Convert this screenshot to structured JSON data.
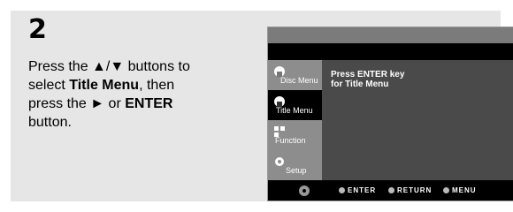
{
  "step": {
    "number": "2"
  },
  "instructions": {
    "line1": "Press the ▲/▼ buttons to",
    "line2_prefix": "select ",
    "line2_bold": "Title Menu",
    "line2_suffix": ", then",
    "line3_prefix": "press the ► or ",
    "line3_bold": "ENTER",
    "line4": "button."
  },
  "osd": {
    "menu": [
      {
        "label": "Disc Menu",
        "icon": "disc-icon",
        "active": false
      },
      {
        "label": "Title Menu",
        "icon": "title-icon",
        "active": true
      },
      {
        "label": "Function",
        "icon": "function-icon",
        "active": false
      },
      {
        "label": "Setup",
        "icon": "gear-icon",
        "active": false
      }
    ],
    "message_line1": "Press ENTER key",
    "message_line2": "for Title Menu",
    "bottom": {
      "enter": "ENTER",
      "return": "RETURN",
      "menu": "MENU"
    }
  },
  "colors": {
    "panel_bg": "#e6e6e6",
    "osd_bg": "#444444",
    "sidebar": "#8d8d8d"
  }
}
